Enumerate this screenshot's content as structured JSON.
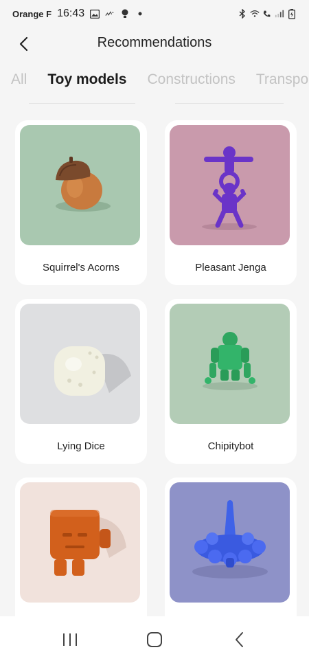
{
  "status_bar": {
    "carrier": "Orange F",
    "time": "16:43"
  },
  "header": {
    "title": "Recommendations"
  },
  "tabs": [
    {
      "label": "All",
      "active": false
    },
    {
      "label": "Toy models",
      "active": true
    },
    {
      "label": "Constructions",
      "active": false
    },
    {
      "label": "Transpo",
      "active": false
    }
  ],
  "cards": [
    {
      "label": "Squirrel's Acorns",
      "bg": "#a9c8b0",
      "icon": "acorn-icon"
    },
    {
      "label": "Pleasant Jenga",
      "bg": "#c99aac",
      "icon": "jenga-figures-icon"
    },
    {
      "label": "Lying Dice",
      "bg": "#dedfe1",
      "icon": "dice-icon"
    },
    {
      "label": "Chipitybot",
      "bg": "#b3ccb6",
      "icon": "robot-icon"
    },
    {
      "label": "",
      "bg": "#f1e2dc",
      "icon": "cube-robot-icon"
    },
    {
      "label": "",
      "bg": "#8e92c8",
      "icon": "spinning-top-icon"
    }
  ],
  "colors": {
    "background": "#f5f5f5",
    "card": "#ffffff",
    "active_tab": "#1c1c1c",
    "inactive_tab": "#c3c3c3"
  }
}
